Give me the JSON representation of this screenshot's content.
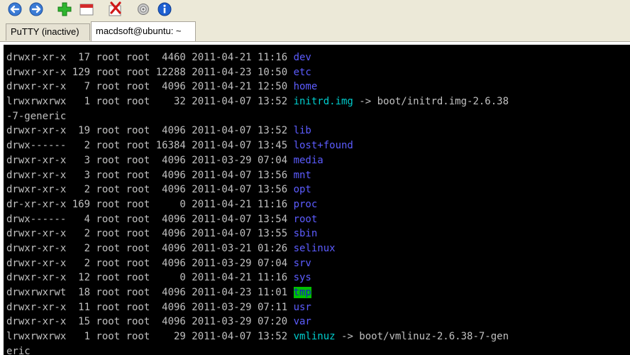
{
  "colors": {
    "dir": "#5c5cff",
    "link": "#00cdcd",
    "tmp_fg": "#1a1acc",
    "tmp_bg": "#00c000"
  },
  "toolbar": [
    {
      "name": "back-icon"
    },
    {
      "name": "forward-icon"
    },
    {
      "name": "add-session-icon"
    },
    {
      "name": "new-window-icon"
    },
    {
      "name": "close-session-icon"
    },
    {
      "name": "settings-icon"
    },
    {
      "name": "info-icon"
    }
  ],
  "tabs": [
    {
      "label": "PuTTY (inactive)",
      "active": false
    },
    {
      "label": "macdsoft@ubuntu: ~",
      "active": true
    }
  ],
  "terminal": {
    "rows": [
      {
        "prefix": "drwxr-xr-x  17 root root  4460 2011-04-21 11:16 ",
        "name": "dev",
        "kind": "dir",
        "suffix": ""
      },
      {
        "prefix": "drwxr-xr-x 129 root root 12288 2011-04-23 10:50 ",
        "name": "etc",
        "kind": "dir",
        "suffix": ""
      },
      {
        "prefix": "drwxr-xr-x   7 root root  4096 2011-04-21 12:50 ",
        "name": "home",
        "kind": "dir",
        "suffix": ""
      },
      {
        "prefix": "lrwxrwxrwx   1 root root    32 2011-04-07 13:52 ",
        "name": "initrd.img",
        "kind": "link",
        "suffix": " -> boot/initrd.img-2.6.38"
      },
      {
        "prefix": "-7-generic",
        "name": "",
        "kind": "none",
        "suffix": ""
      },
      {
        "prefix": "drwxr-xr-x  19 root root  4096 2011-04-07 13:52 ",
        "name": "lib",
        "kind": "dir",
        "suffix": ""
      },
      {
        "prefix": "drwx------   2 root root 16384 2011-04-07 13:45 ",
        "name": "lost+found",
        "kind": "dir",
        "suffix": ""
      },
      {
        "prefix": "drwxr-xr-x   3 root root  4096 2011-03-29 07:04 ",
        "name": "media",
        "kind": "dir",
        "suffix": ""
      },
      {
        "prefix": "drwxr-xr-x   3 root root  4096 2011-04-07 13:56 ",
        "name": "mnt",
        "kind": "dir",
        "suffix": ""
      },
      {
        "prefix": "drwxr-xr-x   2 root root  4096 2011-04-07 13:56 ",
        "name": "opt",
        "kind": "dir",
        "suffix": ""
      },
      {
        "prefix": "dr-xr-xr-x 169 root root     0 2011-04-21 11:16 ",
        "name": "proc",
        "kind": "dir",
        "suffix": ""
      },
      {
        "prefix": "drwx------   4 root root  4096 2011-04-07 13:54 ",
        "name": "root",
        "kind": "dir",
        "suffix": ""
      },
      {
        "prefix": "drwxr-xr-x   2 root root  4096 2011-04-07 13:55 ",
        "name": "sbin",
        "kind": "dir",
        "suffix": ""
      },
      {
        "prefix": "drwxr-xr-x   2 root root  4096 2011-03-21 01:26 ",
        "name": "selinux",
        "kind": "dir",
        "suffix": ""
      },
      {
        "prefix": "drwxr-xr-x   2 root root  4096 2011-03-29 07:04 ",
        "name": "srv",
        "kind": "dir",
        "suffix": ""
      },
      {
        "prefix": "drwxr-xr-x  12 root root     0 2011-04-21 11:16 ",
        "name": "sys",
        "kind": "dir",
        "suffix": ""
      },
      {
        "prefix": "drwxrwxrwt  18 root root  4096 2011-04-23 11:01 ",
        "name": "tmp",
        "kind": "tmp",
        "suffix": ""
      },
      {
        "prefix": "drwxr-xr-x  11 root root  4096 2011-03-29 07:11 ",
        "name": "usr",
        "kind": "dir",
        "suffix": ""
      },
      {
        "prefix": "drwxr-xr-x  15 root root  4096 2011-03-29 07:20 ",
        "name": "var",
        "kind": "dir",
        "suffix": ""
      },
      {
        "prefix": "lrwxrwxrwx   1 root root    29 2011-04-07 13:52 ",
        "name": "vmlinuz",
        "kind": "link",
        "suffix": " -> boot/vmlinuz-2.6.38-7-gen"
      },
      {
        "prefix": "eric",
        "name": "",
        "kind": "none",
        "suffix": ""
      }
    ]
  }
}
